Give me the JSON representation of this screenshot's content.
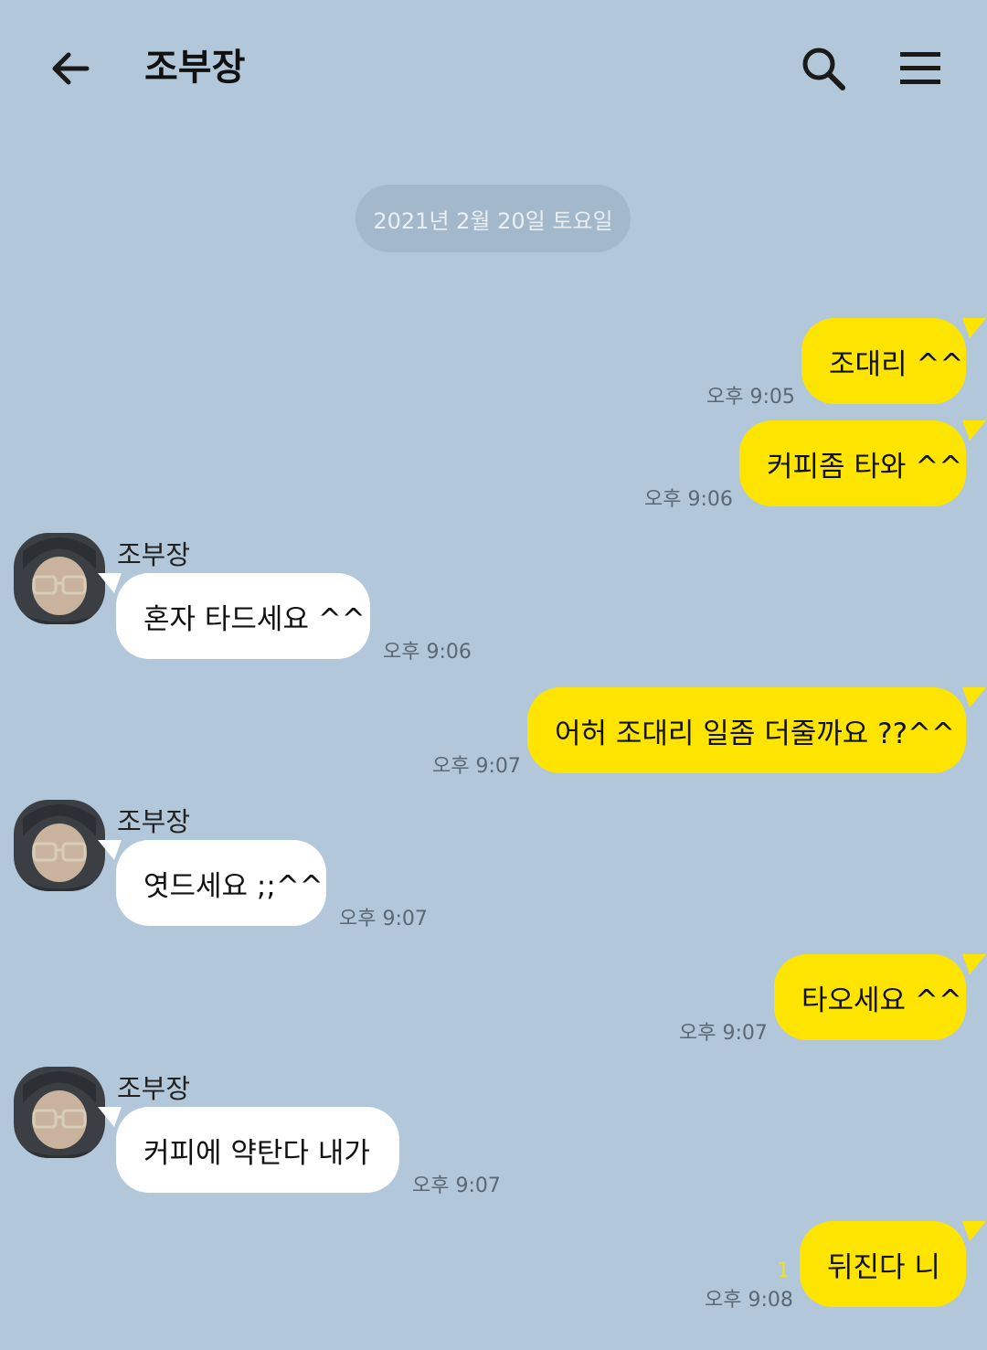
{
  "header": {
    "title": "조부장",
    "back_icon": "arrow-left-icon",
    "search_icon": "search-icon",
    "menu_icon": "hamburger-menu-icon"
  },
  "date_divider": "2021년 2월 20일 토요일",
  "colors": {
    "background": "#b2c7da",
    "my_bubble": "#fee501",
    "their_bubble": "#ffffff",
    "unread_count": "#ece12b"
  },
  "messages": [
    {
      "from": "me",
      "text": "조대리 ^^",
      "time": "오후 9:05"
    },
    {
      "from": "me",
      "text": "커피좀 타와 ^^",
      "time": "오후 9:06"
    },
    {
      "from": "them",
      "sender": "조부장",
      "text": "혼자 타드세요 ^^",
      "time": "오후 9:06"
    },
    {
      "from": "me",
      "text": "어허 조대리 일좀 더줄까요 ??^^",
      "time": "오후 9:07"
    },
    {
      "from": "them",
      "sender": "조부장",
      "text": "엿드세요 ;;^^",
      "time": "오후 9:07"
    },
    {
      "from": "me",
      "text": "타오세요 ^^",
      "time": "오후 9:07"
    },
    {
      "from": "them",
      "sender": "조부장",
      "text": "커피에 약탄다 내가",
      "time": "오후 9:07"
    },
    {
      "from": "me",
      "text": "뒤진다 니",
      "time": "오후 9:08",
      "unread": "1"
    }
  ]
}
